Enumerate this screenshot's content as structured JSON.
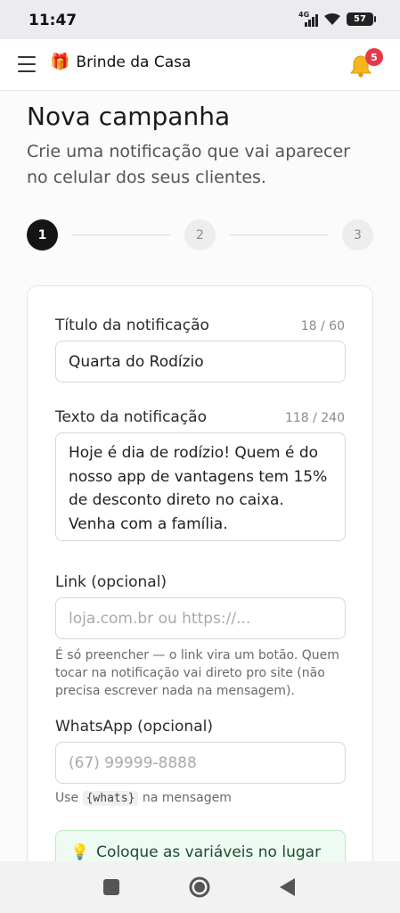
{
  "status": {
    "time": "11:47",
    "network": "4G",
    "battery": "57"
  },
  "app": {
    "name": "Brinde da Casa",
    "logo_emoji": "🎁",
    "notification_count": "5"
  },
  "page": {
    "title": "Nova campanha",
    "subtitle": "Crie uma notificação que vai aparecer no celular dos seus clientes."
  },
  "stepper": {
    "steps": [
      "1",
      "2",
      "3"
    ],
    "current": 1
  },
  "form": {
    "title_field": {
      "label": "Título da notificação",
      "counter": "18 / 60",
      "value": "Quarta do Rodízio"
    },
    "body_field": {
      "label": "Texto da notificação",
      "counter": "118 / 240",
      "value": "Hoje é dia de rodízio! Quem é do nosso app de vantagens tem 15% de desconto direto no caixa. Venha com a família."
    },
    "link_field": {
      "label": "Link (opcional)",
      "placeholder": "loja.com.br ou https://...",
      "help": "É só preencher — o link vira um botão. Quem tocar na notificação vai direto pro site (não precisa escrever nada na mensagem)."
    },
    "whatsapp_field": {
      "label": "WhatsApp (opcional)",
      "placeholder": "(67) 99999-8888",
      "help_prefix": "Use",
      "help_code": "{whats}",
      "help_suffix": "na mensagem"
    },
    "tip": {
      "icon": "💡",
      "text": "Coloque as variáveis no lugar"
    }
  },
  "colors": {
    "accent": "#151515",
    "badge": "#e53948",
    "tip_bg": "#eefbf2",
    "bell": "#f5b81c"
  },
  "icons": {
    "menu": "hamburger-icon",
    "notifications": "bell-icon",
    "nav_recents": "square-icon",
    "nav_home": "circle-icon",
    "nav_back": "triangle-back-icon"
  }
}
